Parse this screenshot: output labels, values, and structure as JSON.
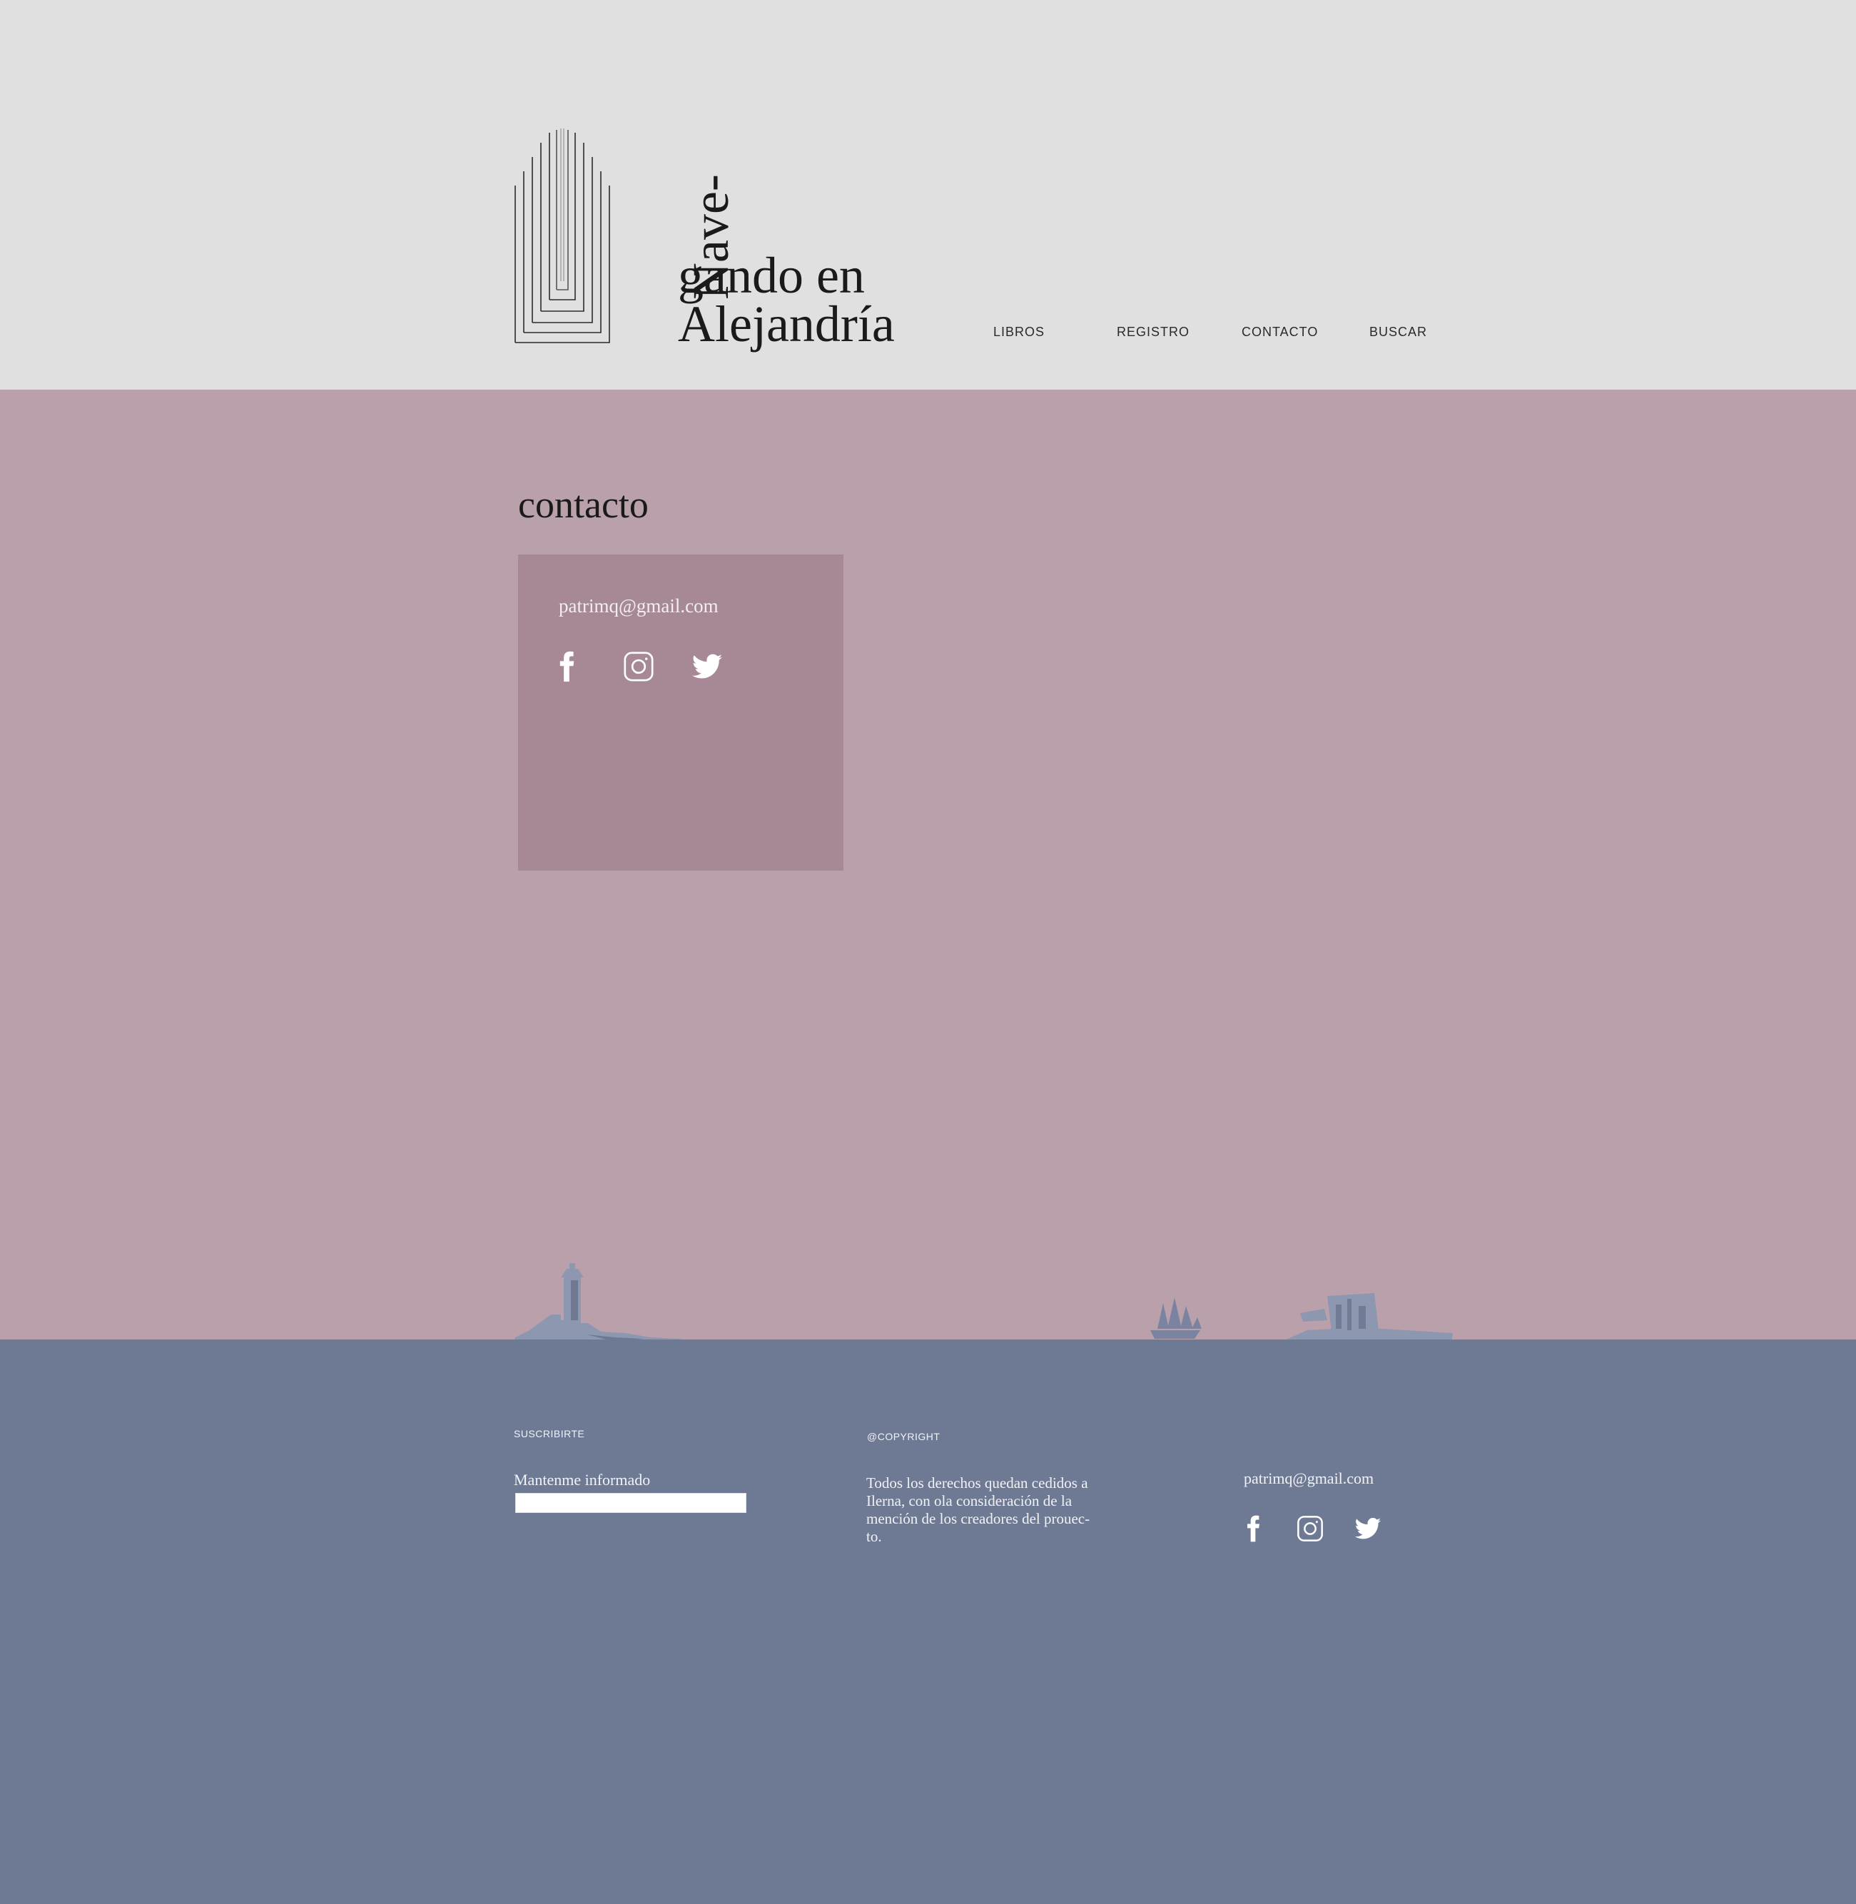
{
  "header": {
    "logo": {
      "rotated_text": "Nave-",
      "line1": "gando en",
      "line2": "Alejandría"
    },
    "nav": [
      {
        "label": "LIBROS"
      },
      {
        "label": "REGISTRO"
      },
      {
        "label": "CONTACTO"
      },
      {
        "label": "BUSCAR"
      }
    ]
  },
  "main": {
    "title": "contacto",
    "card": {
      "email": "patrimq@gmail.com",
      "social": [
        "facebook-icon",
        "instagram-icon",
        "twitter-icon"
      ]
    }
  },
  "footer": {
    "subscribe_label": "SUSCRIBIRTE",
    "subscribe_caption": "Mantenme informado",
    "subscribe_value": "",
    "copyright_label": "@COPYRIGHT",
    "copyright_lines": [
      "Todos los derechos quedan cedidos a",
      "Ilerna, con ola consideración de la",
      "mención de los creadores del prouec-",
      "to."
    ],
    "email": "patrimq@gmail.com",
    "social": [
      "facebook-icon",
      "instagram-icon",
      "twitter-icon"
    ]
  },
  "colors": {
    "header_bg": "#e0e0e0",
    "main_bg": "#baa0aa",
    "card_bg": "#a68896",
    "footer_bg": "#6e7a94",
    "silhouette": "#8e97b0"
  }
}
